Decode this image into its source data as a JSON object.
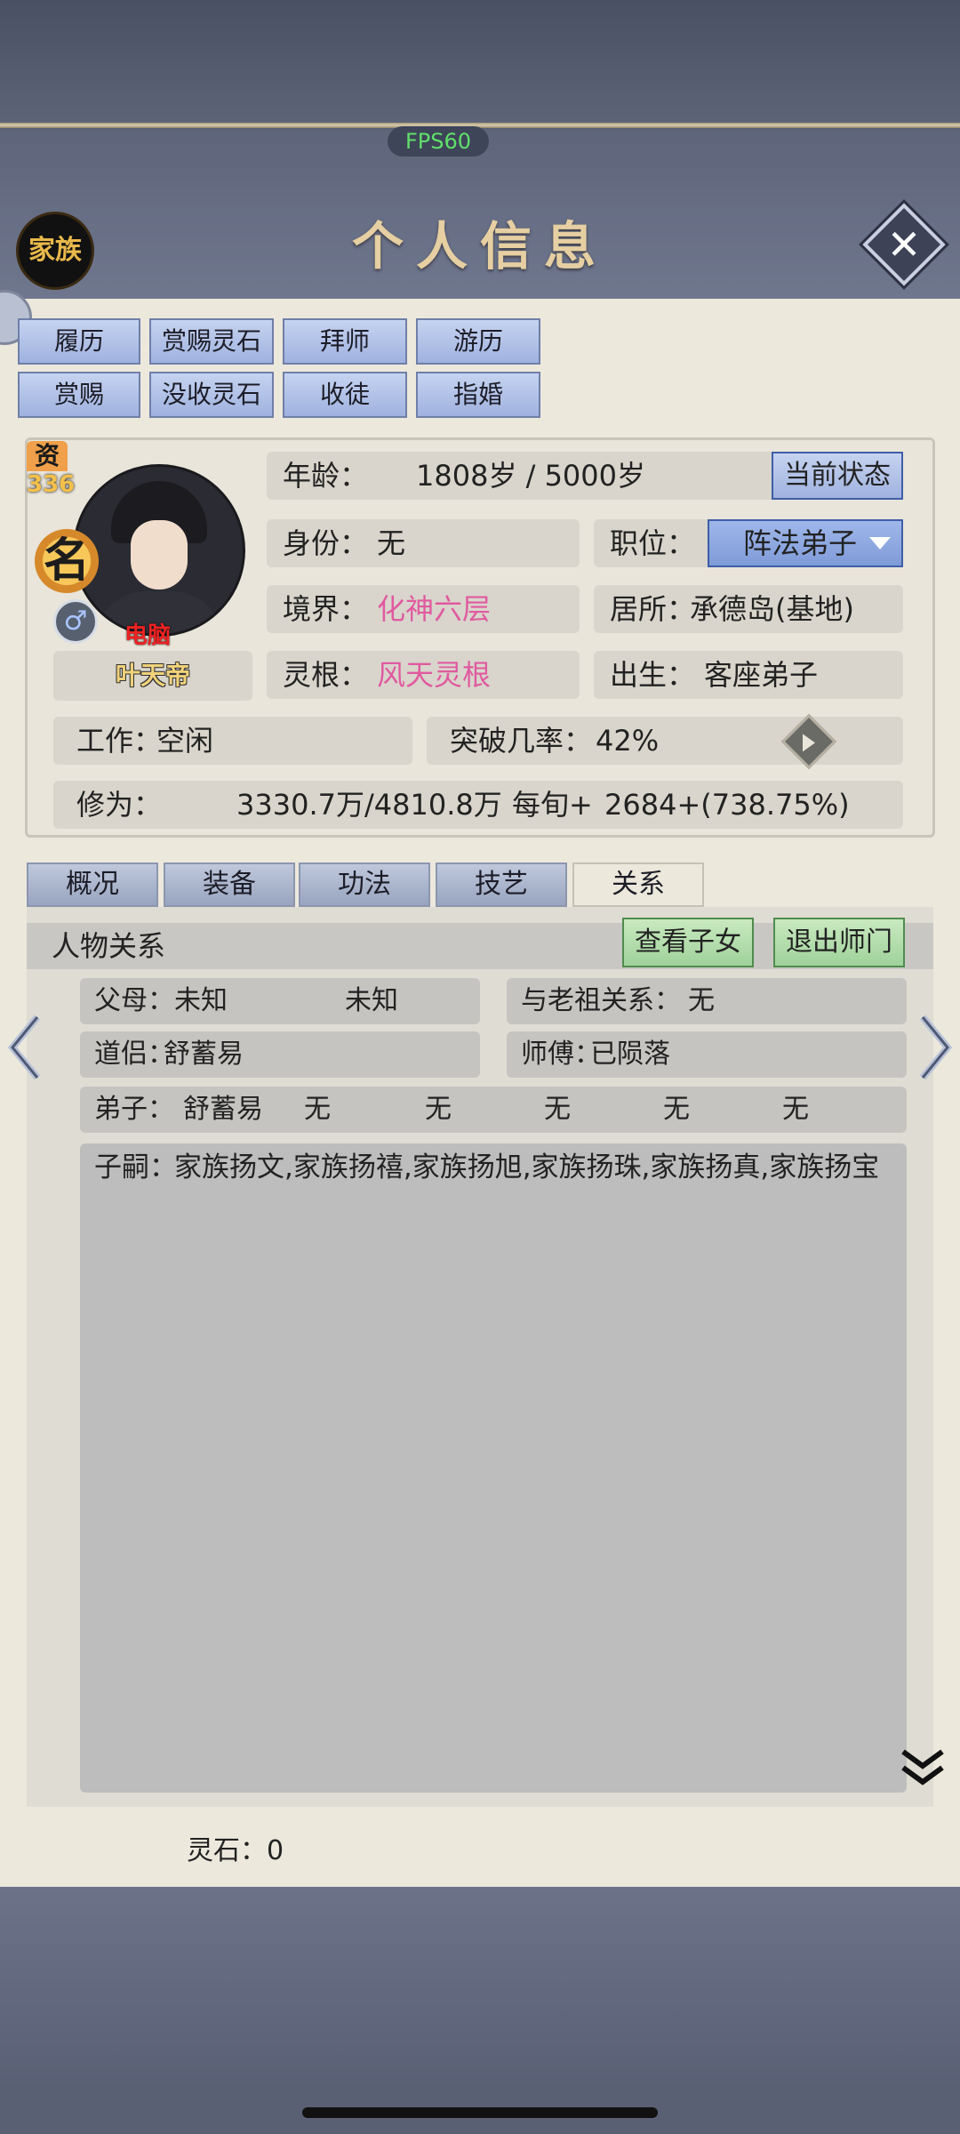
{
  "fps": "FPS60",
  "header": {
    "family_button": "家族",
    "title": "个人信息"
  },
  "actions": [
    "履历",
    "赏赐灵石",
    "拜师",
    "游历",
    "赏赐",
    "没收灵石",
    "收徒",
    "指婚"
  ],
  "badges": {
    "zi_label": "资",
    "zi_value": "336",
    "ming": "名",
    "computer": "电脑"
  },
  "character": {
    "name": "叶天帝",
    "age_label": "年龄：",
    "age_value": "1808岁 / 5000岁",
    "state_button": "当前状态",
    "identity_label": "身份：",
    "identity_value": "无",
    "position_label": "职位：",
    "position_value": "阵法弟子",
    "realm_label": "境界：",
    "realm_value": "化神六层",
    "residence_label": "居所：",
    "residence_value": "承德岛(基地)",
    "root_label": "灵根：",
    "root_value": "风天灵根",
    "birth_label": "出生：",
    "birth_value": "客座弟子",
    "work_label": "工作：",
    "work_value": "空闲",
    "breakthrough_label": "突破几率：",
    "breakthrough_value": "42%",
    "cultivation_label": "修为：",
    "cultivation_value": "3330.7万/4810.8万",
    "per_label": "每旬+",
    "per_value": "2684+(738.75%)"
  },
  "tabs": [
    "概况",
    "装备",
    "功法",
    "技艺",
    "关系"
  ],
  "relations": {
    "title": "人物关系",
    "view_children": "查看子女",
    "leave_sect": "退出师门",
    "parents_label": "父母：",
    "father": "未知",
    "mother": "未知",
    "ancestor_label": "与老祖关系：",
    "ancestor_value": "无",
    "partner_label": "道侣：",
    "partner_value": "舒蓄易",
    "master_label": "师傅：",
    "master_value": "已陨落",
    "disciple_label": "弟子：",
    "disciples": [
      "舒蓄易",
      "无",
      "无",
      "无",
      "无",
      "无"
    ],
    "children_label": "子嗣：",
    "children_value": "家族扬文,家族扬禧,家族扬旭,家族扬珠,家族扬真,家族扬宝"
  },
  "footer": {
    "spirit_stone_label": "灵石：",
    "spirit_stone_value": "0"
  },
  "colors": {
    "accent_blue": "#9fb2df",
    "pink": "#e05aa0",
    "green": "#9fd29a",
    "panel": "#ece8dc"
  }
}
